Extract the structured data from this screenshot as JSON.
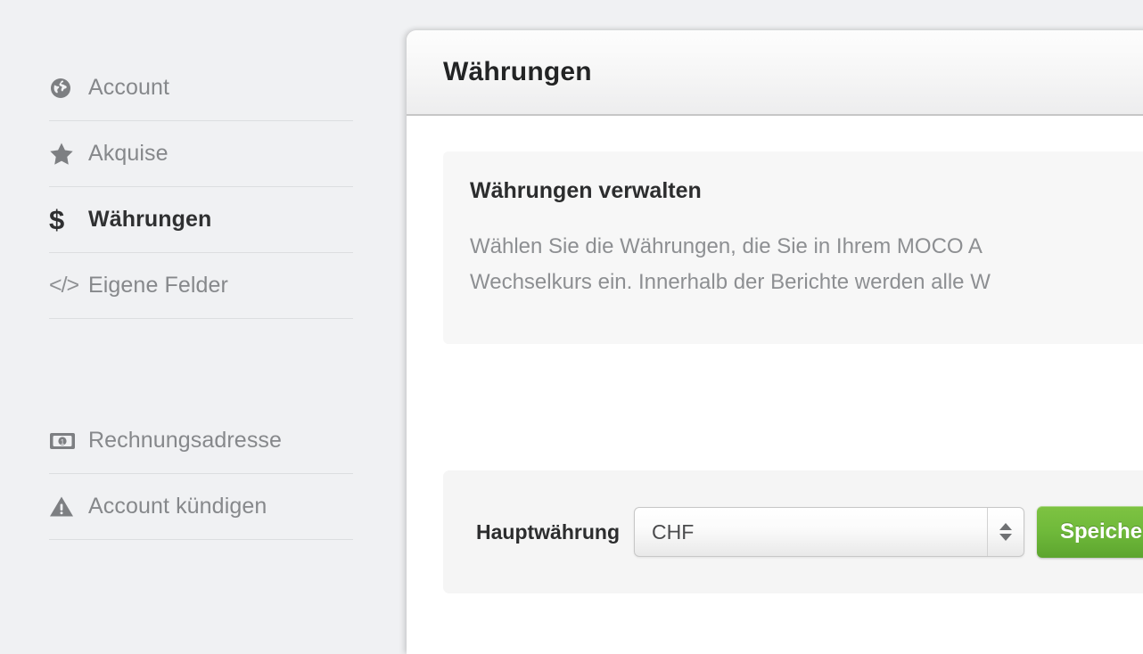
{
  "colors": {
    "page_background": "#f0f1f3",
    "accent_green": "#6fb93a",
    "text_muted": "#86888b",
    "text_dark": "#2c2d2e"
  },
  "sidebar": {
    "groups": [
      {
        "items": [
          {
            "label": "Account",
            "icon": "globe-icon",
            "active": false
          },
          {
            "label": "Akquise",
            "icon": "star-icon",
            "active": false
          },
          {
            "label": "Währungen",
            "icon": "dollar-icon",
            "active": true
          },
          {
            "label": "Eigene Felder",
            "icon": "code-icon",
            "active": false
          }
        ]
      },
      {
        "items": [
          {
            "label": "Rechnungsadresse",
            "icon": "banknote-icon",
            "active": false
          },
          {
            "label": "Account kündigen",
            "icon": "warning-triangle-icon",
            "active": false
          }
        ]
      }
    ]
  },
  "panel": {
    "title": "Währungen",
    "info": {
      "heading": "Währungen verwalten",
      "body": "Wählen Sie die Währungen, die Sie in Ihrem MOCO A\nWechselkurs ein. Innerhalb der Berichte werden alle W"
    },
    "form": {
      "label": "Hauptwährung",
      "select_value": "CHF",
      "select_options": [
        "CHF"
      ],
      "save_label": "Speichern"
    }
  }
}
